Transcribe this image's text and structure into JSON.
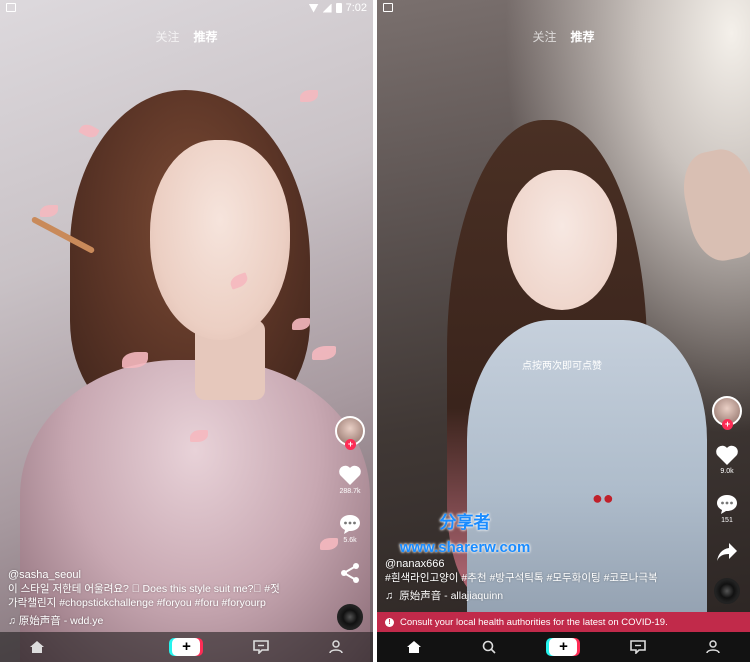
{
  "left_phone": {
    "status_time": "7:02",
    "tabs": {
      "follow": "关注",
      "recommend": "推荐"
    },
    "actions": {
      "likes": "288.7k",
      "comments": "5.6k"
    },
    "caption": {
      "username": "@sasha_seoul",
      "line1": "이 스타일 저한테 어울려요? 🏽      Does this style suit me?🏽     #젓",
      "line2": "가락챌린지 #chopstickchallenge #foryou #foru #foryourp",
      "music": "♫ 原始声音 - wdd.ye"
    }
  },
  "right_phone": {
    "tabs": {
      "follow": "关注",
      "recommend": "推荐"
    },
    "tap_hint": "点按两次即可点赞",
    "actions": {
      "likes": "9.0k",
      "comments": "151"
    },
    "caption": {
      "username": "@nanax666",
      "line1": "#흰색라인고양이 #추천 #방구석틱톡 #모두화이팅 #코로나극복",
      "music": "原始声音 - allajiaquinn"
    },
    "notice": "Consult your local health authorities for the latest on COVID-19."
  },
  "watermark": {
    "line1": "分享者",
    "line2": "www.sharerw.com"
  },
  "colors": {
    "accent_red": "#fe2c55",
    "accent_cyan": "#25f4ee",
    "covid_banner": "#c12a4a",
    "watermark_blue": "#1a8cff"
  },
  "icons": [
    "heart-icon",
    "comment-icon",
    "share-icon",
    "home-icon",
    "search-icon",
    "create-icon",
    "inbox-icon",
    "profile-icon",
    "music-note-icon",
    "info-icon"
  ]
}
